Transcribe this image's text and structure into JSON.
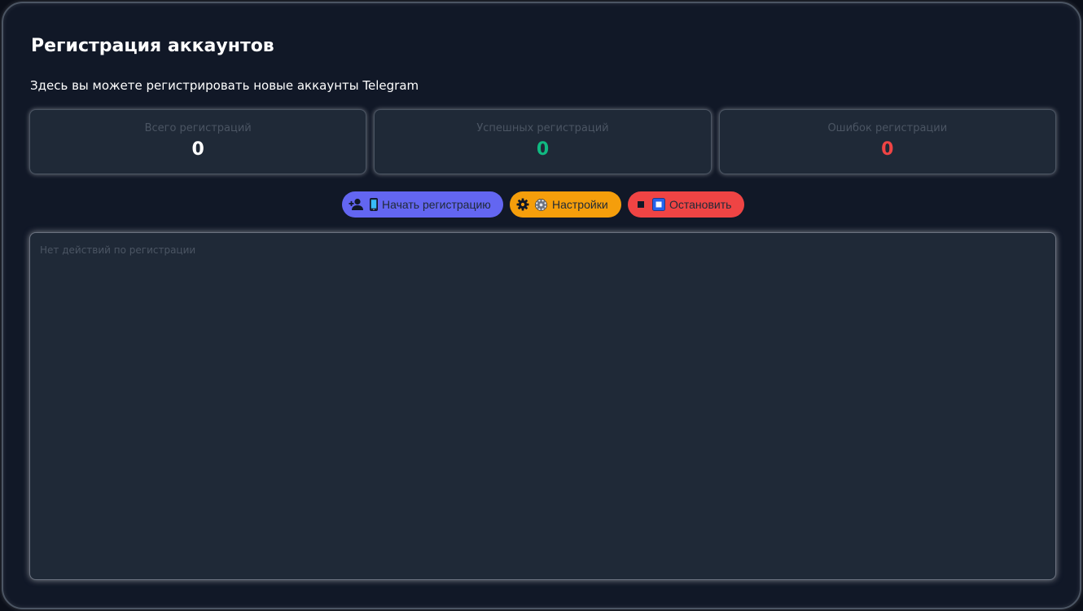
{
  "page": {
    "title": "Регистрация аккаунтов",
    "subtitle": "Здесь вы можете регистрировать новые аккаунты Telegram"
  },
  "stats": [
    {
      "label": "Всего регистраций",
      "value": "0",
      "color": "#ffffff"
    },
    {
      "label": "Успешных регистраций",
      "value": "0",
      "color": "#10b981"
    },
    {
      "label": "Ошибок регистрации",
      "value": "0",
      "color": "#ef4444"
    }
  ],
  "controls": {
    "start": {
      "label": "Начать регистрацию",
      "icon": "person-add-icon",
      "emoji": "mobile-phone-icon",
      "color": "#6366f1"
    },
    "settings": {
      "label": "Настройки",
      "icon": "gear-icon",
      "emoji": "gear-emoji-icon",
      "color": "#f59e0b"
    },
    "stop": {
      "label": "Остановить",
      "icon": "stop-icon",
      "emoji": "stop-button-icon",
      "color": "#ef4444"
    }
  },
  "log": {
    "empty_text": "Нет действий по регистрации"
  },
  "colors": {
    "background": "#111827",
    "card": "#1f2937",
    "muted_text": "#4b5563"
  }
}
